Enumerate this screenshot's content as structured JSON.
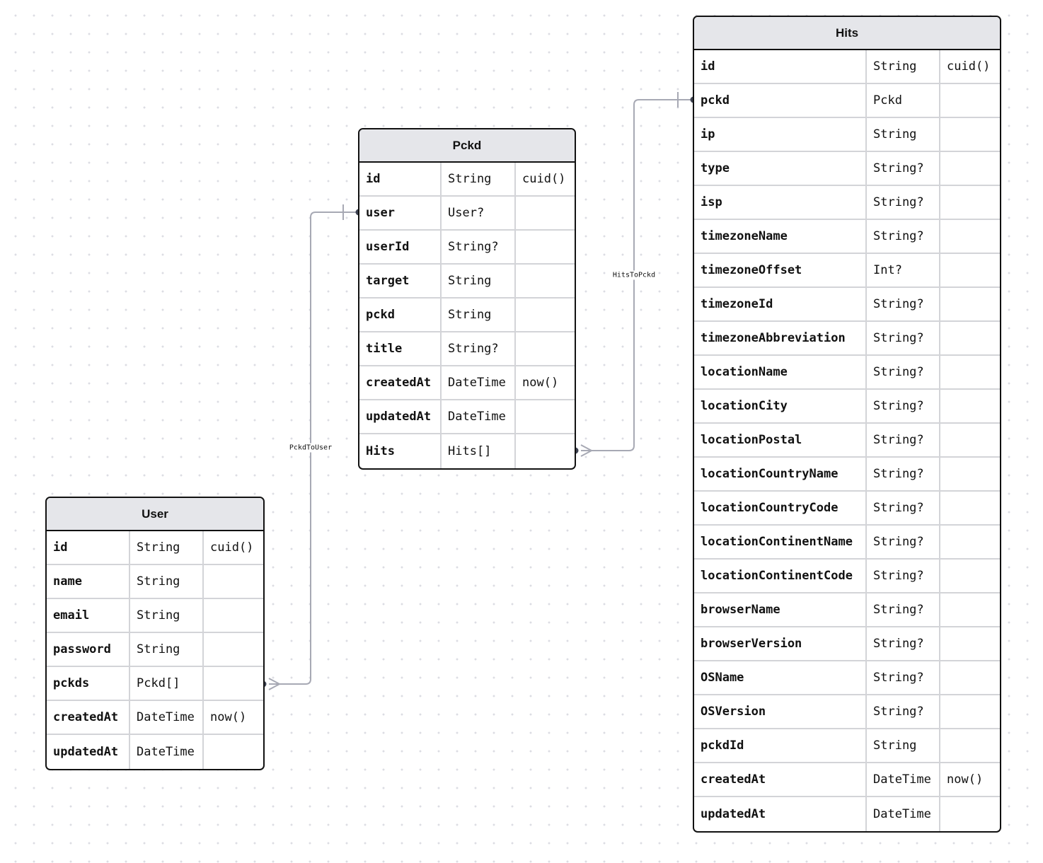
{
  "tables": [
    {
      "name": "Pckd",
      "fields": [
        [
          "id",
          "String",
          "cuid()"
        ],
        [
          "user",
          "User?",
          ""
        ],
        [
          "userId",
          "String?",
          ""
        ],
        [
          "target",
          "String",
          ""
        ],
        [
          "pckd",
          "String",
          ""
        ],
        [
          "title",
          "String?",
          ""
        ],
        [
          "createdAt",
          "DateTime",
          "now()"
        ],
        [
          "updatedAt",
          "DateTime",
          ""
        ],
        [
          "Hits",
          "Hits[]",
          ""
        ]
      ]
    },
    {
      "name": "User",
      "fields": [
        [
          "id",
          "String",
          "cuid()"
        ],
        [
          "name",
          "String",
          ""
        ],
        [
          "email",
          "String",
          ""
        ],
        [
          "password",
          "String",
          ""
        ],
        [
          "pckds",
          "Pckd[]",
          ""
        ],
        [
          "createdAt",
          "DateTime",
          "now()"
        ],
        [
          "updatedAt",
          "DateTime",
          ""
        ]
      ]
    },
    {
      "name": "Hits",
      "fields": [
        [
          "id",
          "String",
          "cuid()"
        ],
        [
          "pckd",
          "Pckd",
          ""
        ],
        [
          "ip",
          "String",
          ""
        ],
        [
          "type",
          "String?",
          ""
        ],
        [
          "isp",
          "String?",
          ""
        ],
        [
          "timezoneName",
          "String?",
          ""
        ],
        [
          "timezoneOffset",
          "Int?",
          ""
        ],
        [
          "timezoneId",
          "String?",
          ""
        ],
        [
          "timezoneAbbreviation",
          "String?",
          ""
        ],
        [
          "locationName",
          "String?",
          ""
        ],
        [
          "locationCity",
          "String?",
          ""
        ],
        [
          "locationPostal",
          "String?",
          ""
        ],
        [
          "locationCountryName",
          "String?",
          ""
        ],
        [
          "locationCountryCode",
          "String?",
          ""
        ],
        [
          "locationContinentName",
          "String?",
          ""
        ],
        [
          "locationContinentCode",
          "String?",
          ""
        ],
        [
          "browserName",
          "String?",
          ""
        ],
        [
          "browserVersion",
          "String?",
          ""
        ],
        [
          "OSName",
          "String?",
          ""
        ],
        [
          "OSVersion",
          "String?",
          ""
        ],
        [
          "pckdId",
          "String",
          ""
        ],
        [
          "createdAt",
          "DateTime",
          "now()"
        ],
        [
          "updatedAt",
          "DateTime",
          ""
        ]
      ]
    }
  ],
  "relations": [
    {
      "name": "PckdToUser",
      "from": "User.pckds",
      "to": "Pckd.user",
      "cardinality": "many-to-one"
    },
    {
      "name": "HitsToPckd",
      "from": "Pckd.Hits",
      "to": "Hits.pckd",
      "cardinality": "many-to-one"
    }
  ],
  "colors": {
    "connector": "#a7a9b4",
    "header": "#e5e6ea",
    "dot": "#3c4150"
  }
}
